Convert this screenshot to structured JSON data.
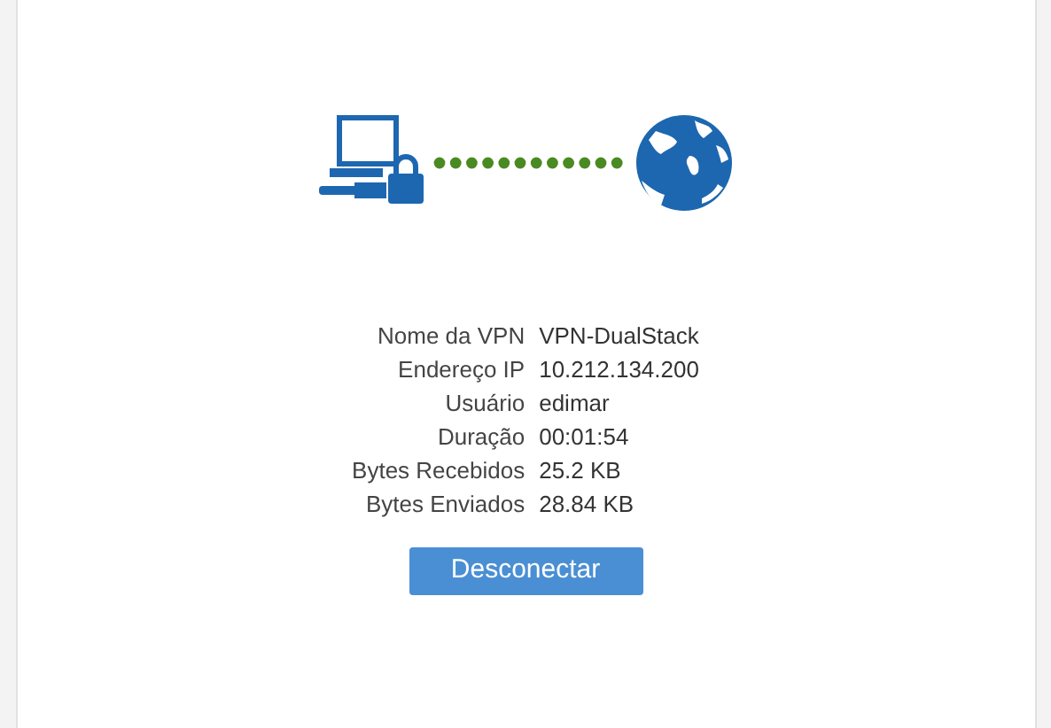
{
  "details": [
    {
      "label": "Nome da VPN",
      "value": "VPN-DualStack"
    },
    {
      "label": "Endereço IP",
      "value": "10.212.134.200"
    },
    {
      "label": "Usuário",
      "value": "edimar"
    },
    {
      "label": "Duração",
      "value": "00:01:54"
    },
    {
      "label": "Bytes Recebidos",
      "value": "25.2 KB"
    },
    {
      "label": "Bytes Enviados",
      "value": "28.84 KB"
    }
  ],
  "button": "Desconectar"
}
